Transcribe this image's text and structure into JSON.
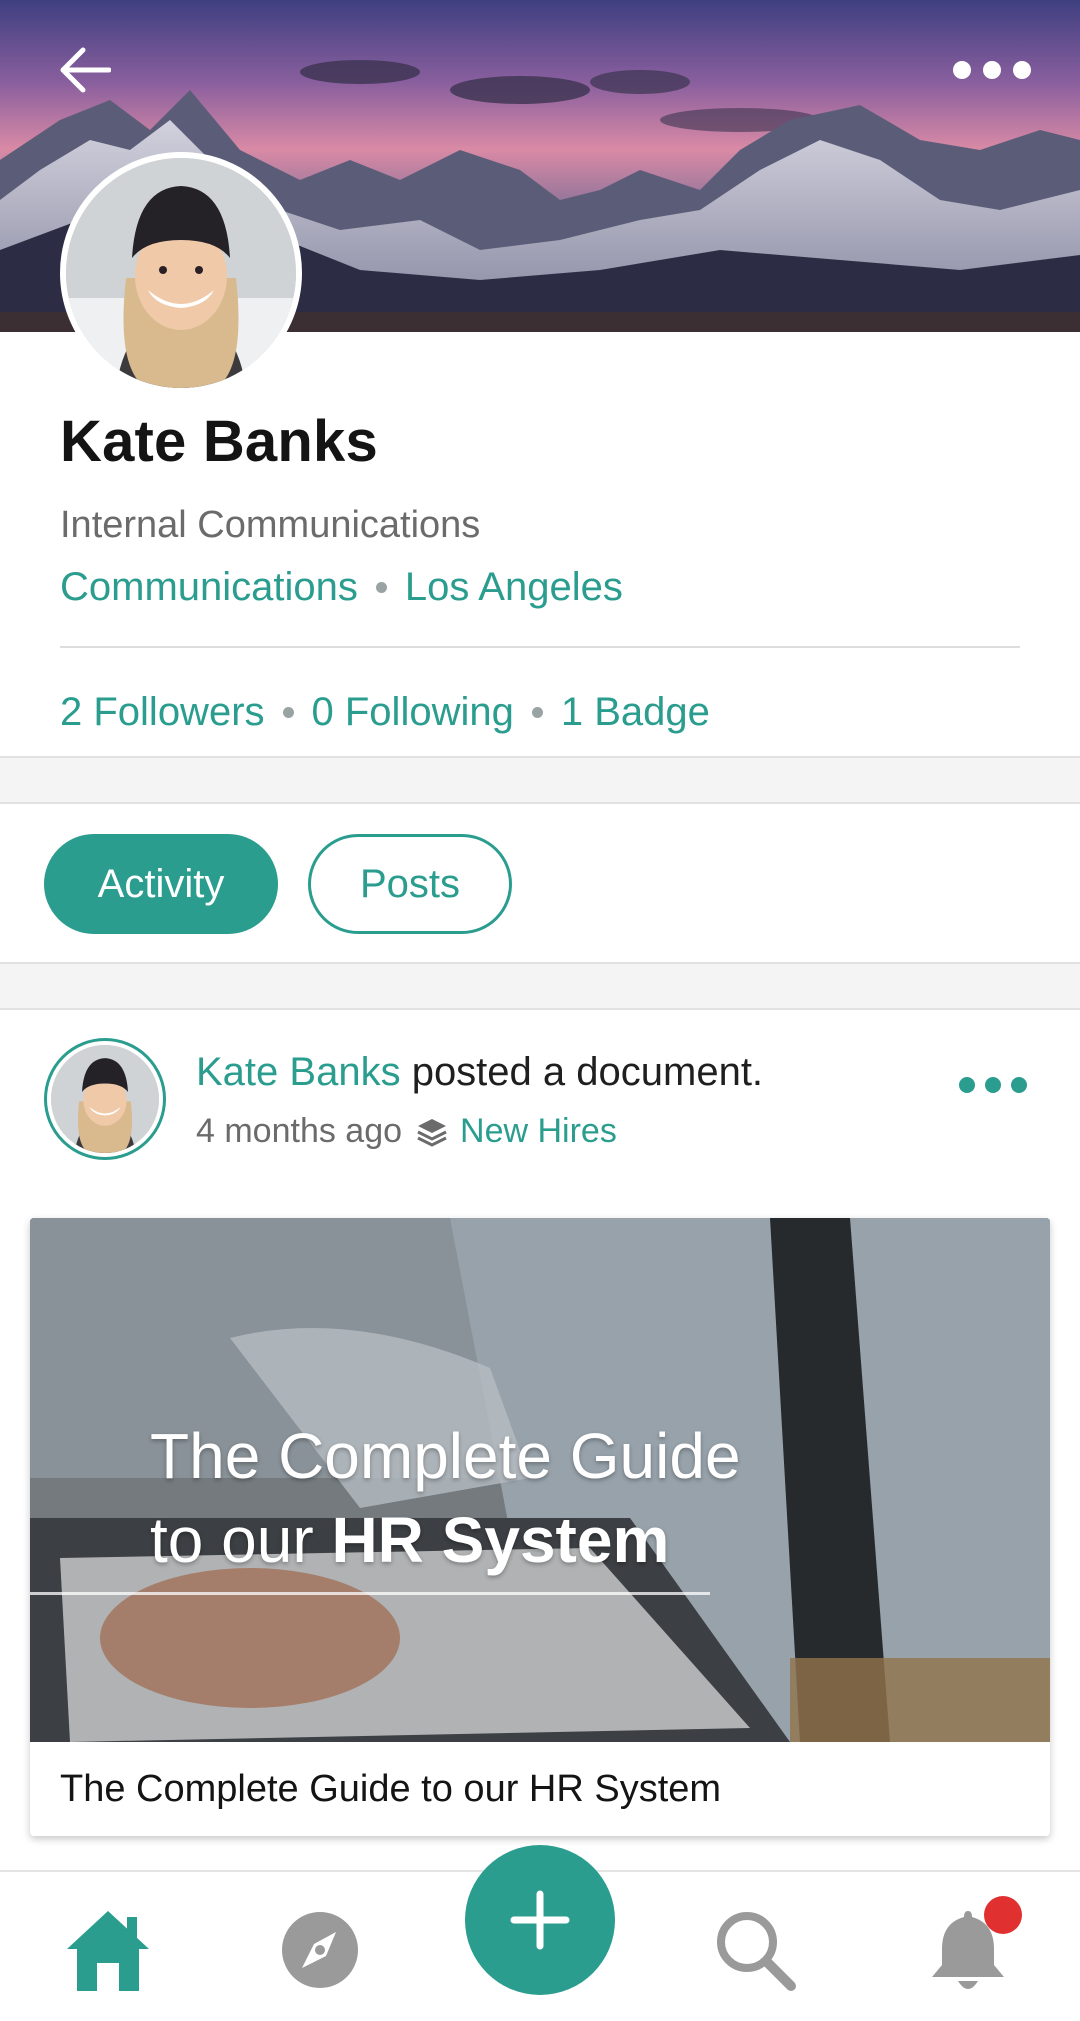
{
  "profile": {
    "name": "Kate Banks",
    "title": "Internal Communications",
    "department": "Communications",
    "location": "Los Angeles"
  },
  "stats": {
    "followers": "2 Followers",
    "following": "0 Following",
    "badges": "1 Badge"
  },
  "tabs": [
    {
      "label": "Activity",
      "active": true
    },
    {
      "label": "Posts",
      "active": false
    }
  ],
  "post": {
    "author": "Kate Banks",
    "action": " posted a document.",
    "time": "4 months ago",
    "group": "New Hires",
    "document": {
      "thumbnail_line1": "The Complete Guide",
      "thumbnail_line2_light": "to our ",
      "thumbnail_line2_bold": "HR System",
      "title": "The Complete Guide to our HR System"
    }
  },
  "nav": {
    "items": [
      "home-icon",
      "compass-icon",
      "plus-icon",
      "search-icon",
      "bell-icon"
    ],
    "notifications_unread": true
  },
  "colors": {
    "accent": "#2a9d8f",
    "badge": "#e0302f"
  }
}
